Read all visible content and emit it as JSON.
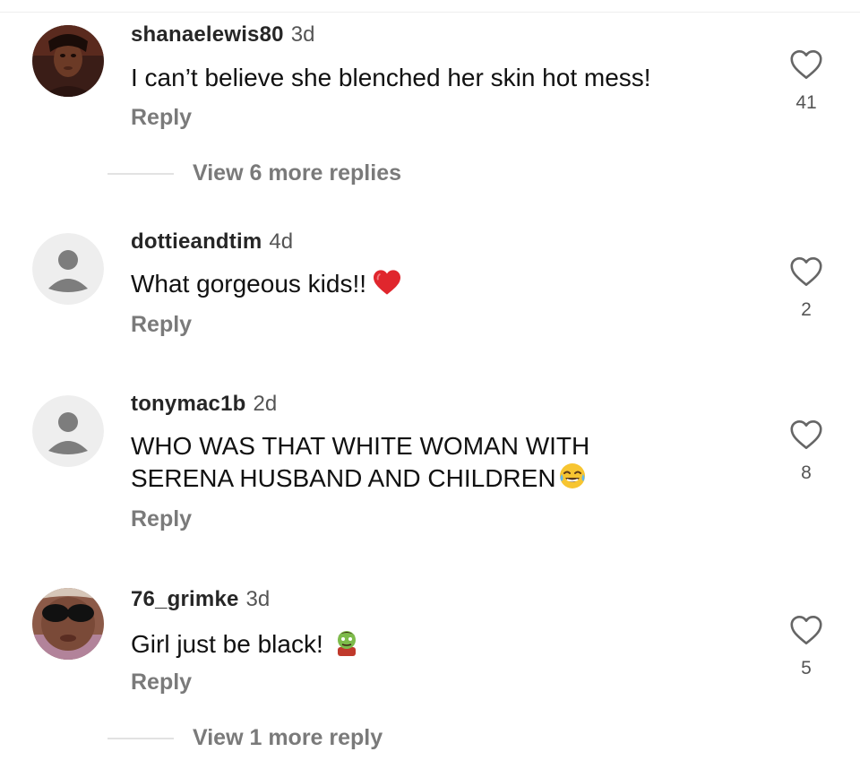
{
  "comments": [
    {
      "username": "shanaelewis80",
      "time": "3d",
      "text": "I can’t believe she blenched her skin hot mess!",
      "reply_label": "Reply",
      "likes": "41",
      "avatar": "user-photo-avatar",
      "view_more": "View 6 more replies"
    },
    {
      "username": "dottieandtim",
      "time": "4d",
      "text": "What gorgeous kids!!",
      "emoji": "red-heart-emoji",
      "reply_label": "Reply",
      "likes": "2",
      "avatar": "default-profile-avatar"
    },
    {
      "username": "tonymac1b",
      "time": "2d",
      "text_line1": "WHO WAS THAT WHITE WOMAN WITH",
      "text_line2": "SERENA HUSBAND AND CHILDREN",
      "emoji": "face-with-tears-of-joy-emoji",
      "reply_label": "Reply",
      "likes": "8",
      "avatar": "default-profile-avatar"
    },
    {
      "username": "76_grimke",
      "time": "3d",
      "text": "Girl just be black!",
      "emoji": "zombie-emoji",
      "reply_label": "Reply",
      "likes": "5",
      "avatar": "user-photo-avatar",
      "view_more": "View 1 more reply"
    }
  ],
  "colors": {
    "text": "#111111",
    "username": "#262626",
    "secondary": "#7a7a7a",
    "default_avatar_bg": "#eeeeee",
    "default_avatar_fg": "#7d7d7d",
    "heart_emoji": "#e0262d"
  }
}
